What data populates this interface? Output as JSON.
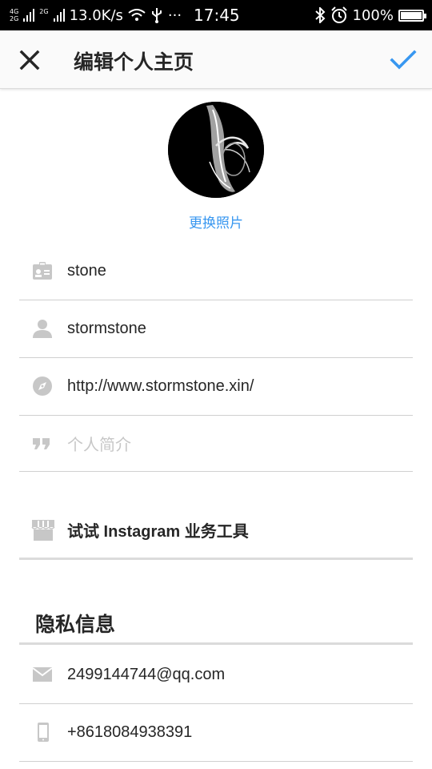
{
  "status_bar": {
    "net_top": "4G",
    "net_bottom": "2G",
    "net_top2": "2G",
    "speed": "13.0K/s",
    "more": "···",
    "time": "17:45",
    "battery_text": "100%",
    "battery_level": 1.0
  },
  "header": {
    "title": "编辑个人主页",
    "close_icon": "close-icon",
    "done_icon": "check-icon"
  },
  "profile": {
    "change_photo_label": "更换照片"
  },
  "fields": {
    "name": {
      "value": "stone",
      "icon": "id-card-icon"
    },
    "username": {
      "value": "stormstone",
      "icon": "person-icon"
    },
    "website": {
      "value": "http://www.stormstone.xin/",
      "icon": "compass-icon"
    },
    "bio": {
      "placeholder": "个人简介",
      "icon": "quote-icon"
    }
  },
  "business": {
    "label": "试试 Instagram 业务工具",
    "icon": "shop-icon"
  },
  "private_info": {
    "title": "隐私信息",
    "email": {
      "value": "2499144744@qq.com",
      "icon": "mail-icon"
    },
    "phone": {
      "value": "+8618084938391",
      "icon": "phone-icon"
    }
  },
  "colors": {
    "accent": "#3897f0",
    "icon_gray": "#c7c7c7",
    "text": "#262626"
  }
}
